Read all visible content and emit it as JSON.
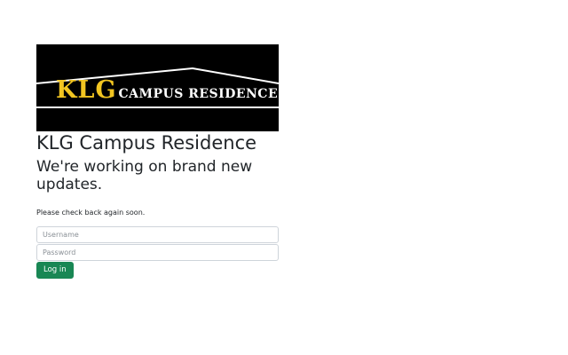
{
  "logo": {
    "brand": "KLG",
    "subtitle": "CAMPUS RESIDENCE",
    "colors": {
      "background": "#000000",
      "brand": "#f2c521",
      "subtitle": "#ffffff",
      "lines": "#ffffff"
    }
  },
  "page": {
    "title": "KLG Campus Residence",
    "headline": "We're working on brand new updates.",
    "message": "Please check back again soon."
  },
  "login": {
    "username_placeholder": "Username",
    "username_value": "",
    "password_placeholder": "Password",
    "password_value": "",
    "button_label": "Log in",
    "button_color": "#198754"
  }
}
